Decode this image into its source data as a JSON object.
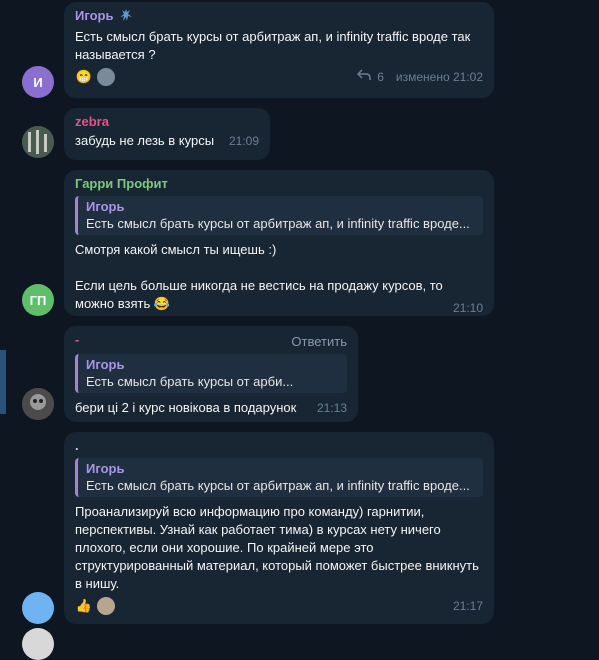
{
  "messages": [
    {
      "sender": "Игорь",
      "text": "Есть смысл брать курсы от арбитраж ап, и infinity traffic вроде так называется ?",
      "views": "6",
      "edited": "изменено 21:02",
      "avatar_initial": "И"
    },
    {
      "sender": "zebra",
      "text": "забудь не лезь в курсы",
      "time": "21:09"
    },
    {
      "sender": "Гарри Профит",
      "quote_name": "Игорь",
      "quote_text": "Есть смысл брать курсы от арбитраж ап, и infinity traffic вроде...",
      "text": "Смотря какой смысл ты ищешь :)\n\nЕсли цель больше никогда не вестись на продажу курсов, то можно взять 😂",
      "time": "21:10",
      "avatar_initial": "ГП"
    },
    {
      "sender": "-",
      "reply_label": "Ответить",
      "quote_name": "Игорь",
      "quote_text": "Есть смысл брать курсы от арби...",
      "text": "бери ці 2 і курс новікова в подарунок",
      "time": "21:13"
    },
    {
      "sender": ".",
      "quote_name": "Игорь",
      "quote_text": "Есть смысл брать курсы от арбитраж ап, и infinity traffic вроде...",
      "text": "Проанализируй всю информацию про команду) гарнитии, перспективы. Узнай как работает тима) в курсах нету ничего плохого, если они хорошие. По крайней мере это структурированный материал, который поможет быстрее вникнуть в нишу.",
      "time": "21:17"
    }
  ],
  "colors": {
    "background": "#0e1621",
    "bubble": "#182533",
    "name_igor": "#a995e6",
    "name_zebra": "#e0558a",
    "name_garri": "#7ec97e",
    "name_dash": "#e0558a"
  },
  "icons": {
    "sender_badge": "jordan-jumpman-icon",
    "reply_arrow": "reply-arrow-icon",
    "reaction_grin": "😁",
    "reaction_thumbs": "👍"
  }
}
